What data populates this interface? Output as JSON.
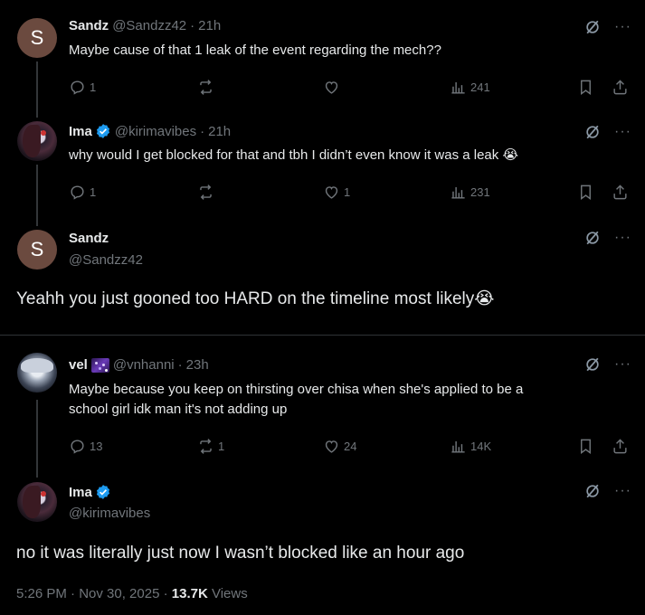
{
  "posts": [
    {
      "name": "Sandz",
      "handle": "@Sandzz42",
      "time": "21h",
      "avatar_letter": "S",
      "text": "Maybe cause of that 1 leak of the event regarding the mech??",
      "replies": "1",
      "reposts": "",
      "likes": "",
      "views": "241"
    },
    {
      "name": "Ima",
      "handle": "@kirimavibes",
      "time": "21h",
      "text": "why would I get blocked for that and tbh I didn’t even know it was a leak 😭",
      "replies": "1",
      "reposts": "",
      "likes": "1",
      "views": "231"
    },
    {
      "name": "Sandz",
      "handle": "@Sandzz42",
      "avatar_letter": "S",
      "text": "Yeahh you just gooned too HARD on the timeline most likely😭"
    },
    {
      "name": "vel",
      "handle": "@vnhanni",
      "time": "23h",
      "text_line1": "Maybe because you keep on thirsting over chisa when she's applied to be a",
      "text_line2": "school girl idk man it's not adding up",
      "replies": "13",
      "reposts": "1",
      "likes": "24",
      "views": "14K"
    },
    {
      "name": "Ima",
      "handle": "@kirimavibes",
      "text": "no it was literally just now I wasn’t blocked like an hour ago"
    }
  ],
  "meta": {
    "timestamp": "5:26 PM · Nov 30, 2025 · ",
    "views_count": "13.7K",
    "views_label": " Views"
  },
  "separator": "·",
  "more_icon": "···",
  "colors": {
    "background": "#000000",
    "text": "#e7e9ea",
    "muted": "#71767b",
    "verified": "#1d9bf0"
  }
}
